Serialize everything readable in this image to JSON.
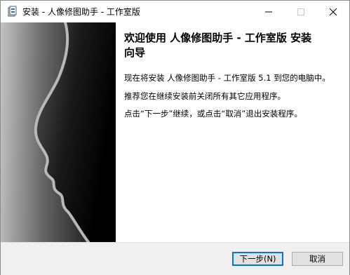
{
  "window": {
    "title": "安装 - 人像修图助手 - 工作室版",
    "controls": {
      "minimize_icon": "minimize-icon",
      "maximize_icon": "maximize-icon",
      "close_icon": "close-icon"
    }
  },
  "left_panel": {
    "image": "face-profile-silhouette"
  },
  "welcome": {
    "heading_line1": "欢迎使用 人像修图助手 - 工作室版 安装",
    "heading_line2": "向导",
    "line1": "现在将安装 人像修图助手 - 工作室版 5.1 到您的电脑中。",
    "line2": "推荐您在继续安装前关闭所有其它应用程序。",
    "line3": "点击“下一步”继续，或点击“取消”退出安装程序。"
  },
  "buttons": {
    "next": "下一步(N)",
    "cancel": "取消"
  },
  "colors": {
    "accent": "#0078d7",
    "footer_bg": "#f0f0f0",
    "button_bg": "#e1e1e1"
  }
}
